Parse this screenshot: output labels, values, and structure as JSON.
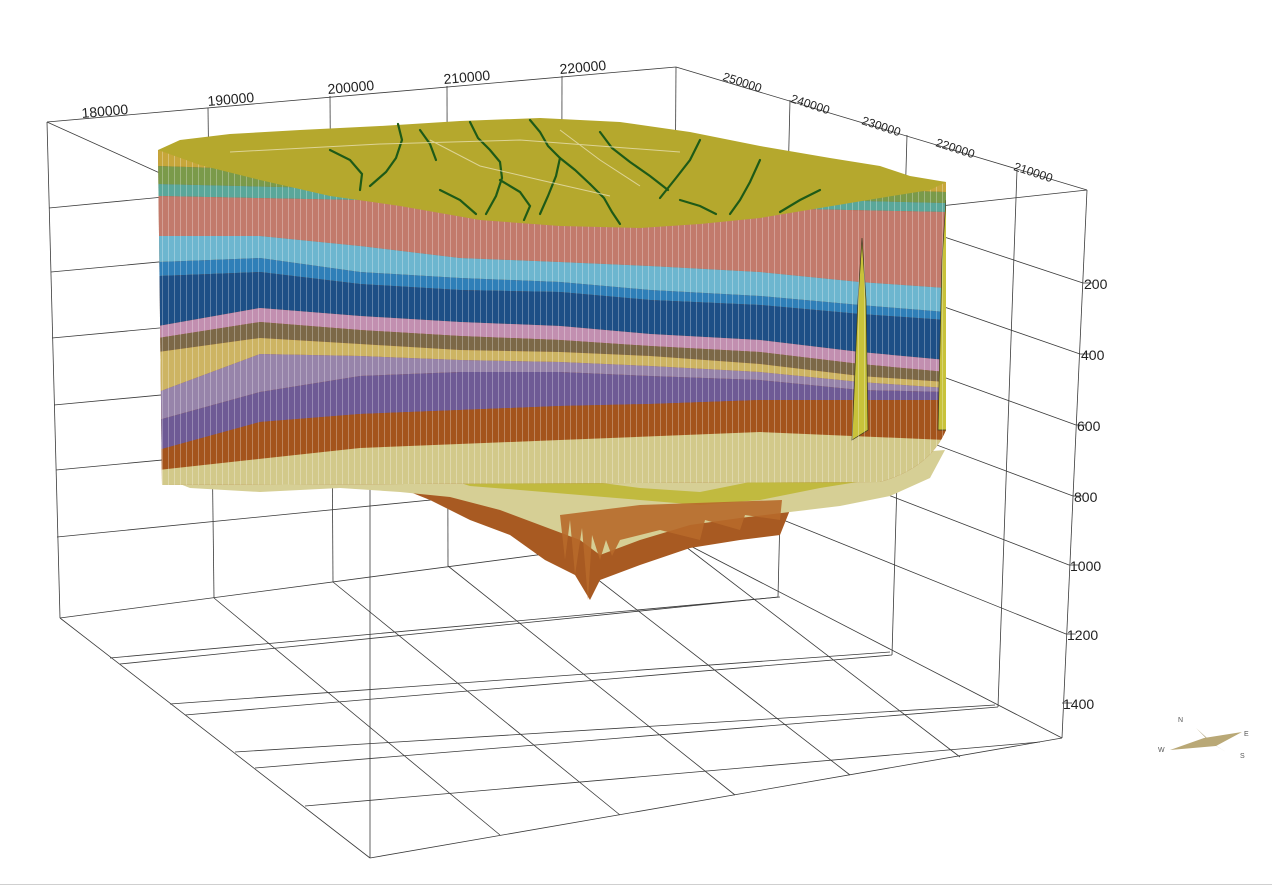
{
  "view": {
    "x_axis_front": {
      "ticks": [
        "180000",
        "190000",
        "200000",
        "210000",
        "220000"
      ]
    },
    "x_axis_right": {
      "ticks": [
        "250000",
        "240000",
        "230000",
        "220000",
        "210000"
      ]
    },
    "depth_axis": {
      "ticks": [
        "200",
        "400",
        "600",
        "800",
        "1000",
        "1200",
        "1400"
      ]
    },
    "compass": {
      "labels": [
        "N",
        "E",
        "S",
        "W"
      ],
      "icon": "compass-rose-icon"
    }
  },
  "model": {
    "surface_color": "#b5a82d",
    "river_color": "#1e5a17",
    "base_color": "#d2c98a",
    "stripe_color": "#ffffff",
    "layers": [
      {
        "color": "#c7a63a"
      },
      {
        "color": "#7a9a4a"
      },
      {
        "color": "#5aa79a"
      },
      {
        "color": "#c27a6c"
      },
      {
        "color": "#6db6cf"
      },
      {
        "color": "#2f7fb8"
      },
      {
        "color": "#1d4f86"
      },
      {
        "color": "#c28fb0"
      },
      {
        "color": "#7c6847"
      },
      {
        "color": "#cdb463"
      },
      {
        "color": "#9784aa"
      },
      {
        "color": "#6e5a95"
      },
      {
        "color": "#a4541c"
      },
      {
        "color": "#d2c98a"
      }
    ]
  }
}
